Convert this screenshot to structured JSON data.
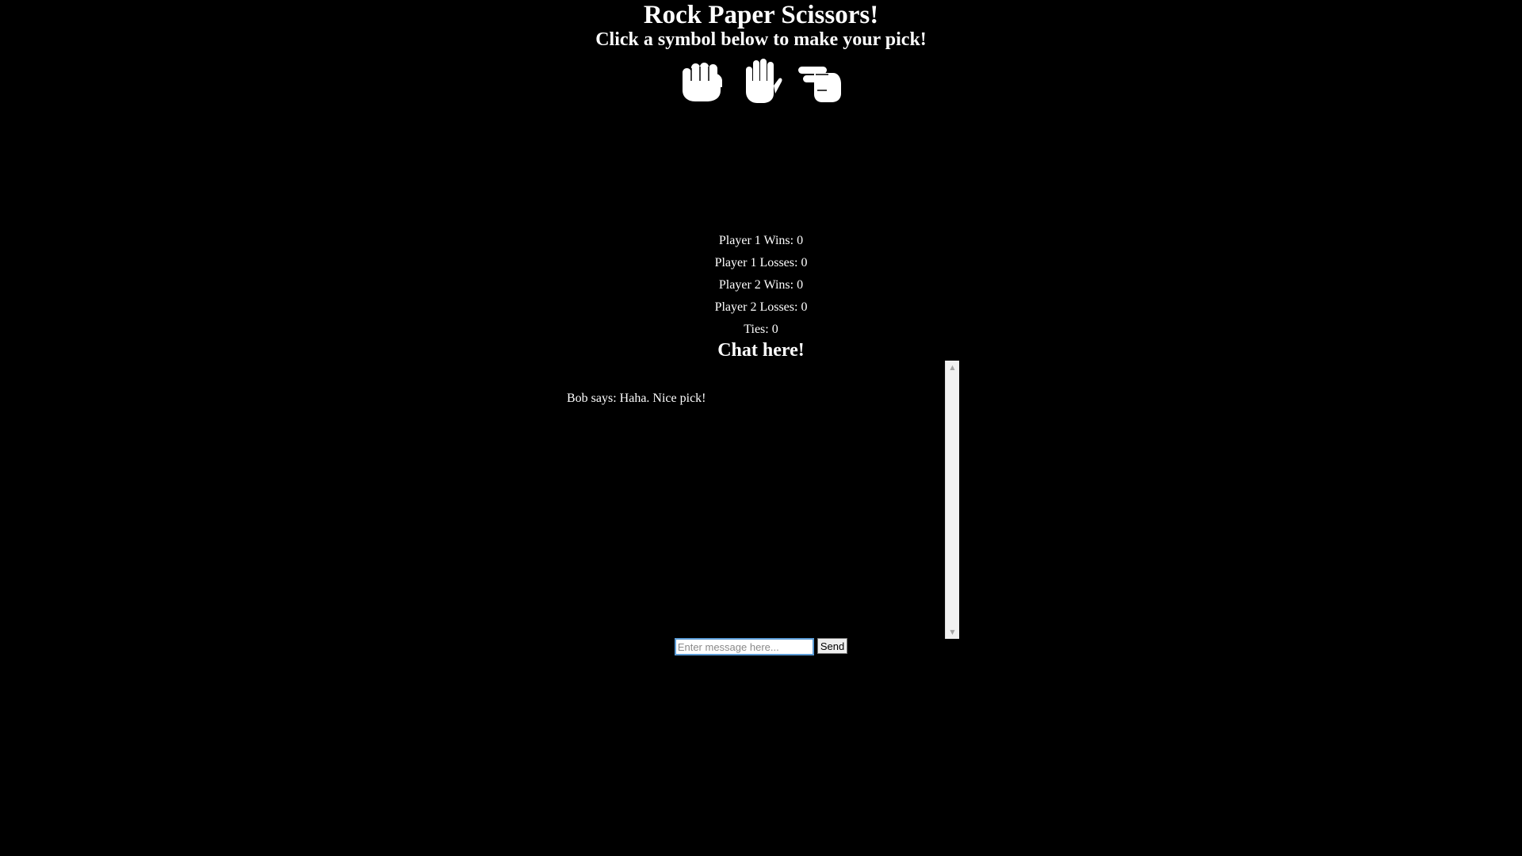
{
  "header": {
    "title": "Rock Paper Scissors!",
    "subtitle": "Click a symbol below to make your pick!"
  },
  "choices": [
    {
      "name": "rock",
      "icon": "fist-icon"
    },
    {
      "name": "paper",
      "icon": "open-hand-icon"
    },
    {
      "name": "scissors",
      "icon": "two-fingers-hand-icon"
    }
  ],
  "stats": {
    "p1_wins": "Player 1 Wins: 0",
    "p1_losses": "Player 1 Losses: 0",
    "p2_wins": "Player 2 Wins: 0",
    "p2_losses": "Player 2 Losses: 0",
    "ties": "Ties: 0"
  },
  "chat": {
    "heading": "Chat here!",
    "messages": [
      "Bob says: Haha. Nice pick!"
    ],
    "input_placeholder": "Enter message here...",
    "send_label": "Send"
  },
  "colors": {
    "background": "#000000",
    "text": "#ffffff",
    "input_focus_border": "#5b9bd5"
  }
}
